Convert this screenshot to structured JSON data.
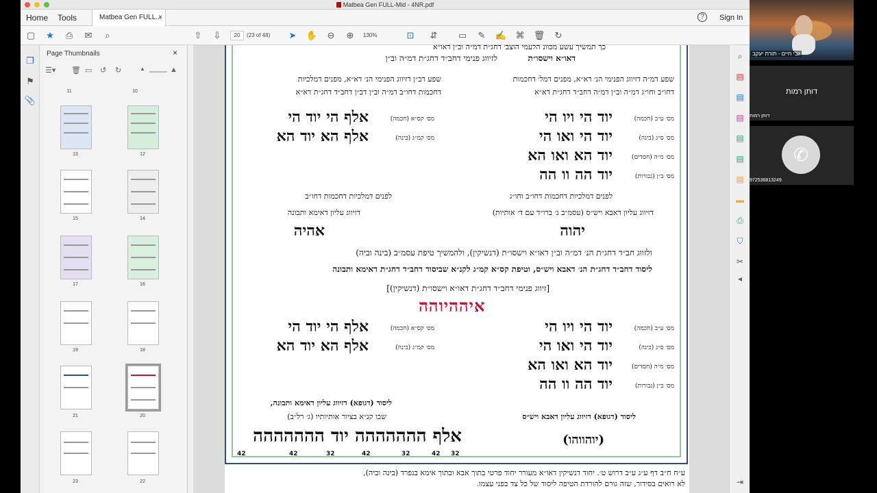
{
  "window": {
    "title": "Matbea Gen FULL-Mid - 4NR.pdf"
  },
  "tabs": {
    "home": "Home",
    "tools": "Tools",
    "doc": "Matbea Gen FULL...",
    "close": "×"
  },
  "header": {
    "help": "?",
    "signin": "Sign In"
  },
  "toolbar": {
    "page": "20",
    "pagecount": "(23 of 48)",
    "zoom": "130%"
  },
  "panel": {
    "title": "Page Thumbnails",
    "close": "×",
    "thumbs": [
      "11",
      "10",
      "13",
      "12",
      "15",
      "14",
      "17",
      "16",
      "19",
      "18",
      "21",
      "20",
      "23",
      "22"
    ]
  },
  "doc": {
    "line0": "כך תמשיך עשע מכוונ הלעמי הוצב׳ דחג״ת דמ״ה וב״ן דאו״א",
    "line1a": "לזיווג פנימי דחב״ד דחג״ת דמ״ה וב״ן",
    "line1b": "דאו״א וישסו״ת",
    "rtop1": "שפע דמ״ה דזיווג הפנימי הנ׳ דא״א, מפנים דמל׳ דחכמות",
    "rtop2": "דחו״ב וחו״ג דמ״ה וב״ן דמ״ה דחב״ד דחג״ת דא״א",
    "ltop1": "שפע דב״ן דזיווג הפנימי הנ׳ דא״א, מפנים דמלכיות",
    "ltop2": "דחכמות דחו״ב דמ״ה וב״ן דב״ן דחב״ד דחג״ת דא״א",
    "m1": "מס׳ ע״ב (חכמה)",
    "m2": "מס׳ ס״ג (בינה)",
    "m3": "מס׳ מ״ה (חסדים)",
    "m4": "מס׳ ב״ן (גבורות)",
    "n1": "יוד הי ויו הי",
    "n2": "יוד הי ואו הי",
    "n3": "יוד הא ואו הא",
    "n4": "יוד הה וו הה",
    "lm1": "מס׳ קס״א (חכמה)",
    "lm2": "מס׳ קמ״ג (בינה)",
    "ln1": "אלף הי יוד הי",
    "ln2": "אלף הא יוד הא",
    "r2a": "לפנים דמלכיות דחכמות דחו״ב וחו״ג",
    "r2b": "דזיווג עליון דאבא ויש״ס (עסמ״ב ג׳ ברו״ד עם ד׳ אותיות)",
    "r2name": "יהוה",
    "l2a": "לפנים דמלכיות דחכמות דחו״ב",
    "l2b": "דזיווג עליון דאימא ותבונה",
    "l2name": "אהיה",
    "c1": "ולזווג חב״ד דחג״ת הנ׳ דמ״ה וב״ן דאו״א וישסו״ת (דנשיקין), ולהמשיך טיפת עסמ״ב (בינה וביה)",
    "c2": "ליסוד דחב״ד דחג״ת הנ׳ דאבא ויש״ס, וטיפת קס״א קמ״ג לקנ״א שביסוד דחב״ד דחג״ת דאימא ותבונה",
    "c3": "[זיווג פנימי דחב״ד דחג״ת דאו״א וישסו״ת (דנשיקין)]",
    "colorname": "איההיוהה",
    "y1": "ליסוד (דגופא) דזיווג עליון דאבא ויש״ס",
    "y2": "ליסוד (דגופא) דזיווג עליון דאימא ותבונה,",
    "y3": "שבו קנ״א בציור אותיותיו (ג׳ רל״ב)",
    "ry": "(יוהווהו)",
    "ly": "אלף ההההההה יוד ההההההה",
    "nums": [
      "42",
      "42",
      "32",
      "42",
      "32",
      "42",
      "32"
    ],
    "foot1": "ע״ח ח״ב דף ע״ג ע״ב דרוש ט׳. יחוד דנשיקין דאו״א מעורר יחוד פרטי בתוך אבא ובתוך אימא בנפרד (בינה וביה),",
    "foot2": "לא רואים בסידור, שזה גורם להורדת הטיפה ליסוד של כל צד בפני עצמו."
  },
  "video": {
    "cap1": "גבי חיים - תורת יעקב",
    "name2": "דותן רמות",
    "cap2": "דותן רמות",
    "cap3": "972536813249"
  },
  "colors": {
    "accent": "#1473e6",
    "frame": "#2e4f74",
    "inner": "#8dc6a6",
    "red": "#c8102e",
    "blue": "#1f4fa0"
  }
}
